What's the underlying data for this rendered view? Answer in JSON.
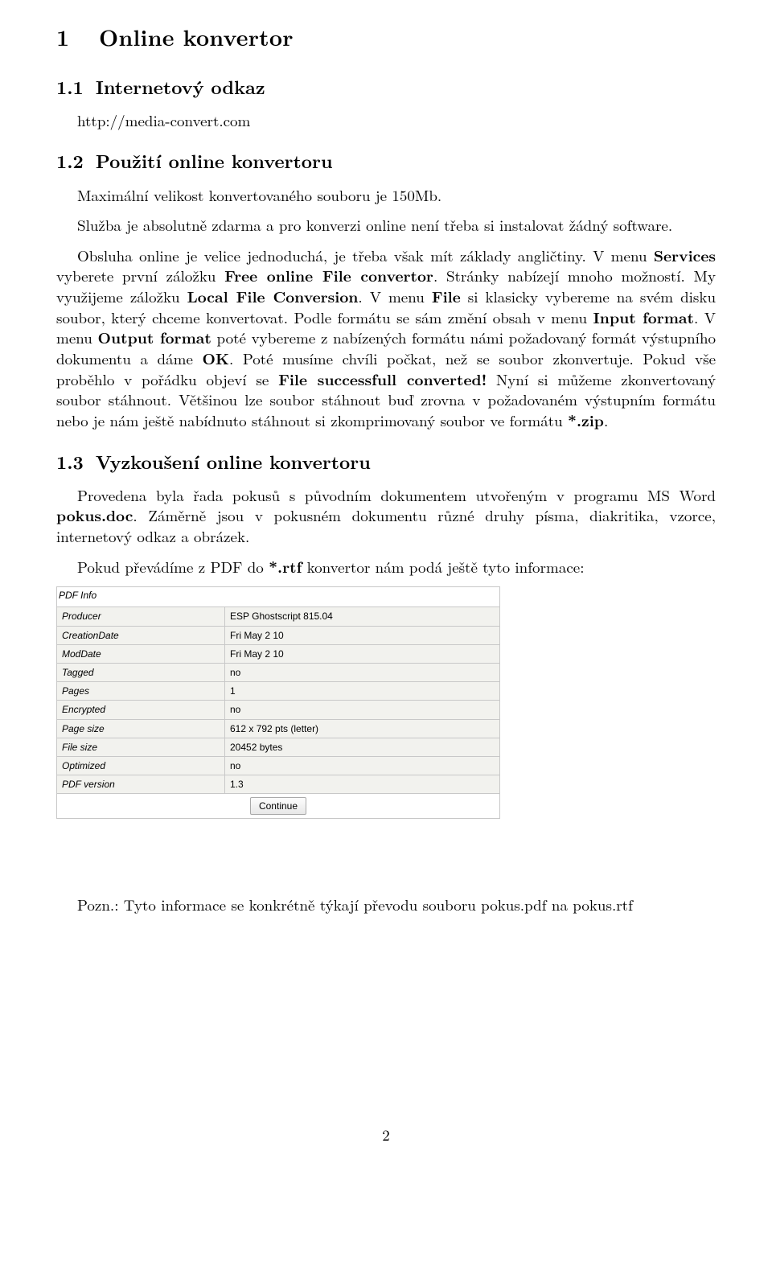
{
  "section": {
    "number": "1",
    "title": "Online konvertor"
  },
  "sub1": {
    "number": "1.1",
    "title": "Internetový odkaz",
    "link": "http://media-convert.com"
  },
  "sub2": {
    "number": "1.2",
    "title": "Použití online konvertoru",
    "p1": "Maximální velikost konvertovaného souboru je 150Mb.",
    "p2a": "Služba je absolutně zdarma a pro konverzi online není třeba si instalovat žádný software.",
    "p3a": "Obsluha online je velice jednoduchá, je třeba však mít základy angličtiny. V menu ",
    "b1": "Services",
    "p3b": " vyberete první záložku ",
    "b2": "Free online File convertor",
    "p3c": ". Stránky nabízejí mnoho možností. My využijeme záložku ",
    "b3": "Local File Conversion",
    "p3d": ". V menu ",
    "b4": "File",
    "p3e": " si klasicky vybereme na svém disku soubor, který chceme konvertovat. Podle formátu se sám změní obsah v menu ",
    "b5": "Input format",
    "p3f": ". V menu ",
    "b6": "Output format",
    "p3g": " poté vybereme z nabízených formátu námi požadovaný formát výstupního dokumentu a dáme ",
    "b7": "OK",
    "p3h": ". Poté musíme chvíli počkat, než se soubor zkonvertuje. Pokud vše proběhlo v pořádku objeví se ",
    "b8": "File successfull converted!",
    "p3i": " Nyní si můžeme zkonvertovaný soubor stáhnout. Většinou lze soubor stáhnout buď zrovna v požadovaném výstupním formátu nebo je nám ještě nabídnuto stáhnout si zkomprimovaný soubor ve formátu ",
    "b9": "*.zip",
    "p3j": "."
  },
  "sub3": {
    "number": "1.3",
    "title": "Vyzkoušení online konvertoru",
    "p1a": "Provedena byla řada pokusů s původním dokumentem utvořeným v programu MS Word ",
    "b1": "pokus.doc",
    "p1b": ". Záměrně jsou v pokusném dokumentu různé druhy písma, diakritika, vzorce, internetový odkaz a obrázek.",
    "p2a": "Pokud převádíme z PDF do ",
    "b2": "*.rtf",
    "p2b": " konvertor nám podá ještě tyto informace:"
  },
  "pdfinfo": {
    "title": "PDF Info",
    "rows": [
      {
        "k": "Producer",
        "v": "ESP Ghostscript 815.04"
      },
      {
        "k": "CreationDate",
        "v": "Fri May 2 10"
      },
      {
        "k": "ModDate",
        "v": "Fri May 2 10"
      },
      {
        "k": "Tagged",
        "v": "no"
      },
      {
        "k": "Pages",
        "v": "1"
      },
      {
        "k": "Encrypted",
        "v": "no"
      },
      {
        "k": "Page size",
        "v": "612 x 792 pts (letter)"
      },
      {
        "k": "File size",
        "v": "20452 bytes"
      },
      {
        "k": "Optimized",
        "v": "no"
      },
      {
        "k": "PDF version",
        "v": "1.3"
      }
    ],
    "button": "Continue"
  },
  "note": "Pozn.: Tyto informace se konkrétně týkají převodu souboru pokus.pdf na pokus.rtf",
  "page_number": "2"
}
